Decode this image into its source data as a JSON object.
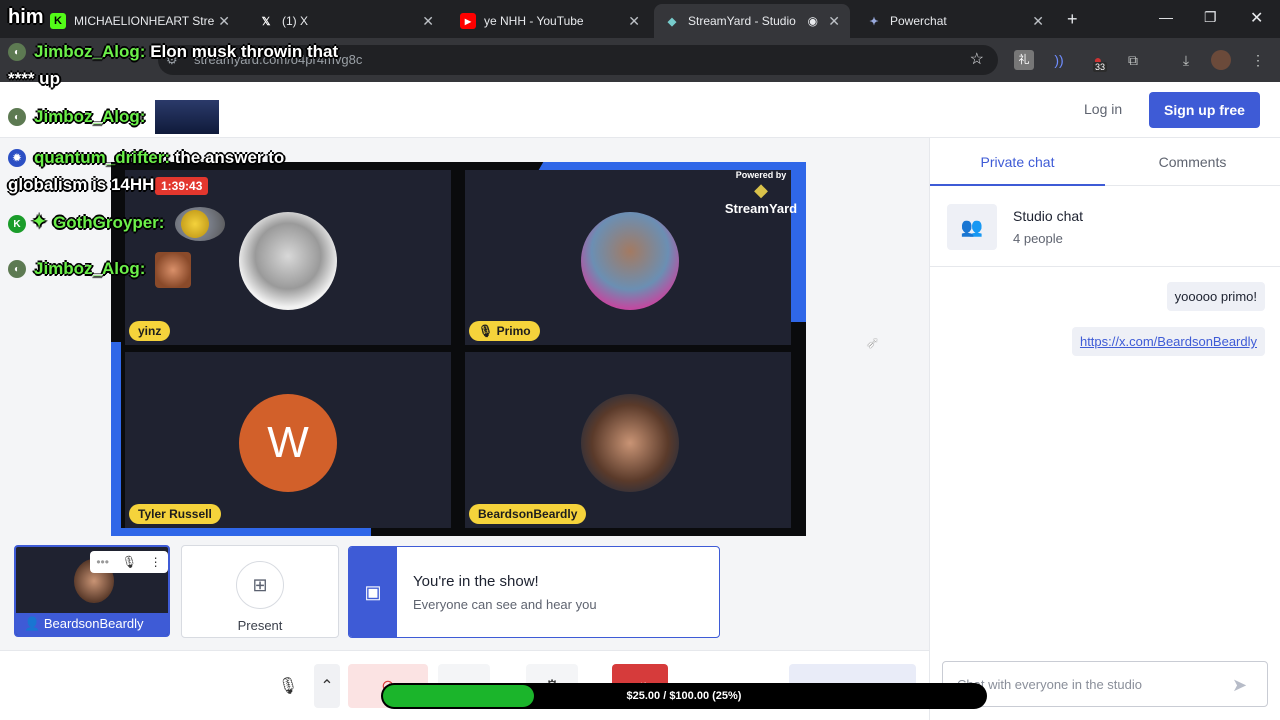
{
  "browser": {
    "tabs": [
      {
        "title": "MICHAELIONHEART Stre",
        "icon": "kick-icon"
      },
      {
        "title": "(1) X",
        "icon": "x-icon"
      },
      {
        "title": "ye NHH - YouTube",
        "icon": "youtube-icon"
      },
      {
        "title": "StreamYard - Studio",
        "icon": "streamyard-icon"
      },
      {
        "title": "Powerchat",
        "icon": "powerchat-icon"
      }
    ],
    "url": "streamyard.com/o4pr4mvg8c",
    "extension_badge": "33"
  },
  "header": {
    "login": "Log in",
    "signup": "Sign up free"
  },
  "stage": {
    "timer": "1:39:43",
    "powered_by": "Powered by",
    "brand": "StreamYard",
    "participants": [
      {
        "name": "yinz"
      },
      {
        "name": "Primo",
        "muted": true
      },
      {
        "name": "Tyler Russell",
        "initial": "W"
      },
      {
        "name": "BeardsonBeardly"
      }
    ]
  },
  "self_tile": {
    "name": "BeardsonBeardly"
  },
  "present": {
    "label": "Present"
  },
  "in_show": {
    "title": "You're in the show!",
    "subtitle": "Everyone can see and hear you"
  },
  "panel": {
    "tabs": [
      "Private chat",
      "Comments"
    ],
    "studio_chat": {
      "title": "Studio chat",
      "subtitle": "4 people"
    },
    "messages": [
      "yooooo primo!",
      "https://x.com/BeardsonBeardly"
    ],
    "input_placeholder": "Chat with everyone in the studio"
  },
  "overlay_chat": [
    {
      "user": "Jimboz_Alog:",
      "text": "Elon musk throwin that",
      "text2": "**** up"
    },
    {
      "user": "Jimboz_Alog:",
      "text": ""
    },
    {
      "user": "quantum_drifter:",
      "text": "the answer to",
      "text2": "globalism is 14HH"
    },
    {
      "user": "GothGroyper:",
      "text": ""
    },
    {
      "user": "Jimboz_Alog:",
      "text": ""
    }
  ],
  "overlay_label": "him",
  "goal": {
    "text": "$25.00 / $100.00 (25%)",
    "progress": 0.25
  },
  "colors": {
    "accent": "#3e5bd6",
    "nametag": "#f5d33b",
    "chat_name": "#6cf04a",
    "goal": "#1bb52b"
  }
}
